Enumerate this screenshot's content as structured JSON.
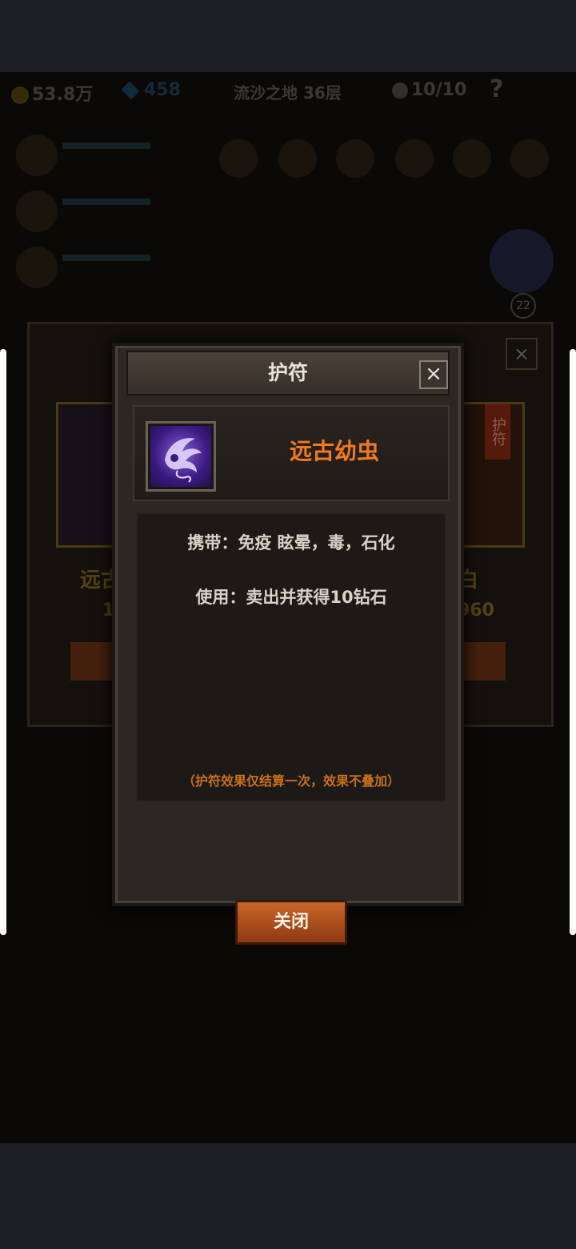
{
  "hud": {
    "gold": "53.8万",
    "gems": "458",
    "location": "流沙之地 36层",
    "lives": "10/10",
    "help": "?"
  },
  "background": {
    "card_left_name": "远古",
    "card_left_price": "1",
    "card_right_price": "960",
    "card_right_name": "白",
    "card_right_tag": "护符",
    "badge_count": "22"
  },
  "dialog": {
    "title": "护符",
    "close_icon": "×",
    "item_name": "远古幼虫",
    "carry_text": "携带：免疫 眩晕，毒，石化",
    "use_text": "使用：卖出并获得10钻石",
    "note": "（护符效果仅结算一次，效果不叠加）",
    "close_button": "关闭"
  },
  "colors": {
    "item_name": "#f07a1c",
    "note": "#c8701a",
    "button": "#c9652a"
  }
}
